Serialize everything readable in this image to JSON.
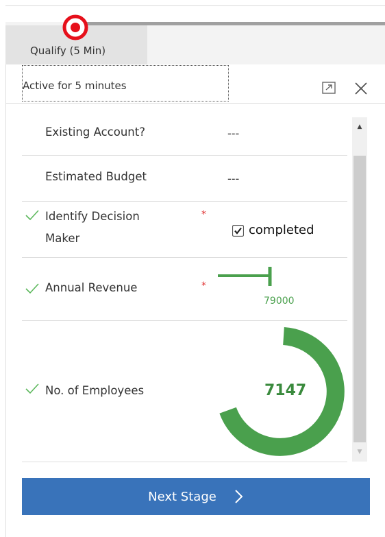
{
  "stage": {
    "label": "Qualify  (5 Min)"
  },
  "panel": {
    "active_text": "Active for 5 minutes"
  },
  "fields": [
    {
      "label": "Existing Account?",
      "value": "---",
      "completed": false,
      "required": false
    },
    {
      "label": "Estimated Budget",
      "value": "---",
      "completed": false,
      "required": false
    },
    {
      "label_line1": "Identify Decision",
      "label_line2": "Maker",
      "value": "completed",
      "checked": true,
      "completed": true,
      "required": true,
      "required_mark": "*"
    },
    {
      "label": "Annual Revenue",
      "value": "79000",
      "completed": true,
      "required": true,
      "required_mark": "*"
    },
    {
      "label": "No. of Employees",
      "value": "7147",
      "completed": true,
      "required": false
    }
  ],
  "next_button": {
    "label": "Next Stage"
  },
  "colors": {
    "accent": "#3973ba",
    "gauge_green": "#4aa04d",
    "check_green": "#5cb85c",
    "target_red": "#e6101b"
  },
  "icons": [
    "target-icon",
    "pop-out-icon",
    "close-icon",
    "check-icon",
    "chevron-right-icon",
    "scroll-up-icon",
    "scroll-down-icon"
  ]
}
